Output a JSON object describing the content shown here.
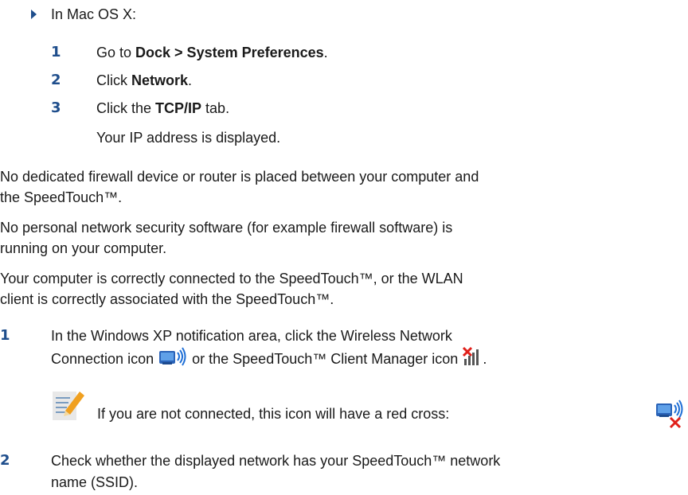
{
  "mac": {
    "intro": "In Mac OS X:",
    "steps": [
      {
        "num": "1",
        "pre": "Go to ",
        "bold": "Dock > System Preferences",
        "post": "."
      },
      {
        "num": "2",
        "pre": "Click ",
        "bold": "Network",
        "post": "."
      },
      {
        "num": "3",
        "pre": "Click the ",
        "bold": "TCP/IP",
        "post": " tab."
      }
    ],
    "result": "Your IP address is displayed."
  },
  "para1": {
    "line1": "No dedicated firewall device or router is placed between your computer and",
    "line2": "the SpeedTouch™."
  },
  "para2": {
    "line1": "No personal network security software (for example firewall software) is",
    "line2": "running on your computer."
  },
  "para3": {
    "line1": "Your computer is correctly connected to the SpeedTouch™, or the WLAN",
    "line2": "client is correctly associated with the SpeedTouch™."
  },
  "step1": {
    "num": "1",
    "line1": "In the Windows XP notification area, click the Wireless Network",
    "line2_pre": "Connection icon",
    "line2_mid": "or the SpeedTouch™ Client Manager icon",
    "line2_post": "."
  },
  "note": {
    "text": "If you are not connected, this icon will have a red cross:"
  },
  "step2": {
    "num": "2",
    "line1": "Check whether the displayed network has your SpeedTouch™ network",
    "line2": "name (SSID)."
  },
  "icons": {
    "bullet": "triangle-bullet-icon",
    "wireless": "wireless-network-icon",
    "client_manager": "client-manager-icon",
    "wireless_disconnected": "wireless-disconnected-icon",
    "note": "note-pencil-icon"
  },
  "colors": {
    "step_number": "#1f4e8c",
    "red_cross": "#e0201a"
  }
}
